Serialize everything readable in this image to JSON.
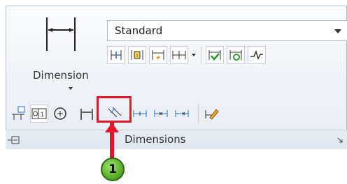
{
  "ribbon": {
    "big_button": {
      "label": "Dimension",
      "icon": "dimension-large-icon"
    },
    "dim_style": {
      "value": "Standard"
    },
    "row1_icons": [
      "dim-baseline-icon",
      "dim-chain-icon",
      "dim-override-icon",
      "dim-continuous-icon",
      "dim-dropdown-icon",
      "dim-check-icon",
      "dim-update-icon",
      "dim-break-icon"
    ],
    "row2_icons": [
      "annotate-icon",
      "feature-control-frame-icon",
      "center-mark-icon",
      "smart-dimension-icon",
      "dim-oblique-icon",
      "dim-space-icon",
      "dim-align-icon",
      "dim-jog-icon",
      "dim-edit-icon"
    ],
    "panel_title": "Dimensions"
  },
  "callout": {
    "number": "1"
  },
  "colors": {
    "highlight": "#e3172a",
    "callout_fill": "#5cb52a",
    "accent_blue": "#1c6fd1"
  }
}
